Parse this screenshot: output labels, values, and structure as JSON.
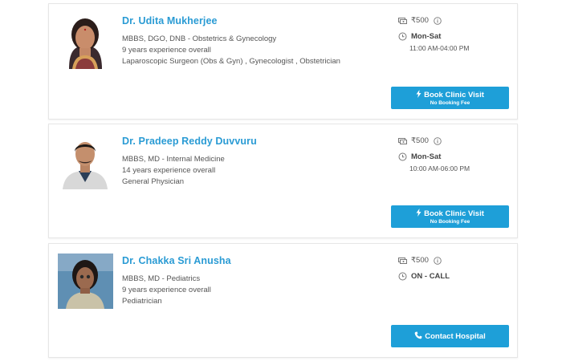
{
  "doctors": [
    {
      "name": "Dr. Udita Mukherjee",
      "qualification": "MBBS, DGO, DNB - Obstetrics & Gynecology",
      "experience": "9 years experience overall",
      "specialties": "Laparoscopic Surgeon (Obs & Gyn) , Gynecologist , Obstetrician",
      "fee": "₹500",
      "days": "Mon-Sat",
      "hours": "11:00 AM-04:00 PM",
      "button_label": "Book Clinic Visit",
      "button_sub": "No Booking Fee",
      "button_icon": "bolt-icon"
    },
    {
      "name": "Dr. Pradeep Reddy Duvvuru",
      "qualification": "MBBS, MD - Internal Medicine",
      "experience": "14 years experience overall",
      "specialties": "General Physician",
      "fee": "₹500",
      "days": "Mon-Sat",
      "hours": "10:00 AM-06:00 PM",
      "button_label": "Book Clinic Visit",
      "button_sub": "No Booking Fee",
      "button_icon": "bolt-icon"
    },
    {
      "name": "Dr. Chakka Sri Anusha",
      "qualification": "MBBS, MD - Pediatrics",
      "experience": "9 years experience overall",
      "specialties": "Pediatrician",
      "fee": "₹500",
      "days": "ON - CALL",
      "hours": "",
      "button_label": "Contact Hospital",
      "button_sub": "",
      "button_icon": "phone-icon"
    }
  ],
  "colors": {
    "accent": "#2a9bd4",
    "button": "#1e9fd8",
    "card_border": "#e6e6e6",
    "text": "#555555"
  }
}
